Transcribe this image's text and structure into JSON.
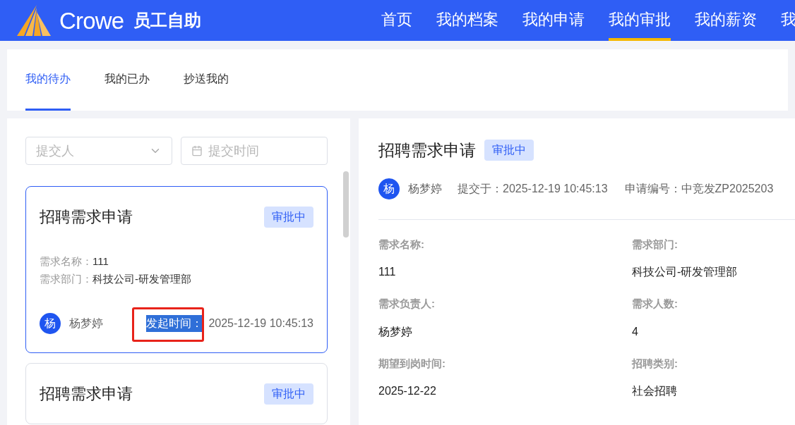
{
  "header": {
    "logo_text": "Crowe",
    "app_title": "员工自助",
    "nav": [
      {
        "label": "首页",
        "selected": false
      },
      {
        "label": "我的档案",
        "selected": false
      },
      {
        "label": "我的申请",
        "selected": false
      },
      {
        "label": "我的审批",
        "selected": true
      },
      {
        "label": "我的薪资",
        "selected": false
      },
      {
        "label": "我",
        "selected": false
      }
    ]
  },
  "tabs": [
    {
      "label": "我的待办",
      "selected": true
    },
    {
      "label": "我的已办",
      "selected": false
    },
    {
      "label": "抄送我的",
      "selected": false
    }
  ],
  "filters": [
    {
      "kind": "select",
      "placeholder": "提交人"
    },
    {
      "kind": "date",
      "placeholder": "提交时间"
    }
  ],
  "cards": [
    {
      "title": "招聘需求申请",
      "status": "审批中",
      "selected": true,
      "fields": [
        {
          "label": "需求名称：",
          "value": "111"
        },
        {
          "label": "需求部门：",
          "value": "科技公司-研发管理部"
        }
      ],
      "avatar": "杨",
      "name": "杨梦婷",
      "time_label": "发起时间：",
      "time_label_highlighted": true,
      "annotated": true,
      "time": "2025-12-19 10:45:13"
    },
    {
      "title": "招聘需求申请",
      "status": "审批中",
      "selected": false
    }
  ],
  "detail": {
    "title": "招聘需求申请",
    "status": "审批中",
    "avatar": "杨",
    "name": "杨梦婷",
    "submitted": "提交于：2025-12-19 10:45:13",
    "number": "申请编号：中竞发ZP2025203",
    "fields": [
      {
        "label": "需求名称:",
        "value": "111"
      },
      {
        "label": "需求部门:",
        "value": "科技公司-研发管理部"
      },
      {
        "label": "需求负责人:",
        "value": "杨梦婷"
      },
      {
        "label": "需求人数:",
        "value": "4"
      },
      {
        "label": "期望到岗时间:",
        "value": "2025-12-22"
      },
      {
        "label": "招聘类别:",
        "value": "社会招聘"
      }
    ]
  }
}
